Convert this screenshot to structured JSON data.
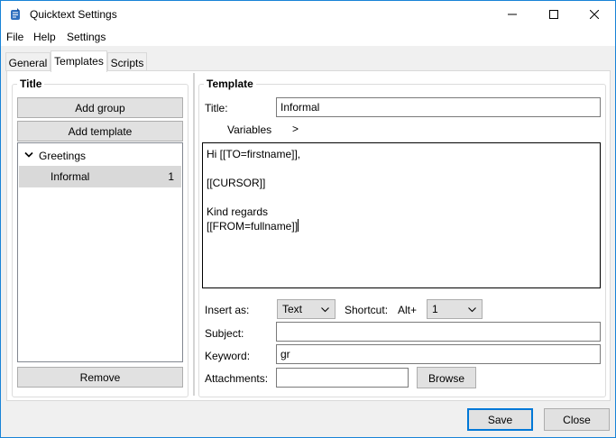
{
  "window": {
    "title": "Quicktext Settings"
  },
  "menu": [
    "File",
    "Help",
    "Settings"
  ],
  "tabs": [
    {
      "label": "General",
      "active": false
    },
    {
      "label": "Templates",
      "active": true
    },
    {
      "label": "Scripts",
      "active": false
    }
  ],
  "left_panel": {
    "title": "Title",
    "add_group_label": "Add group",
    "add_template_label": "Add template",
    "tree": {
      "group_label": "Greetings",
      "item_label": "Informal",
      "item_shortcut": "1"
    },
    "remove_label": "Remove"
  },
  "right_panel": {
    "title": "Template",
    "title_label": "Title:",
    "title_value": "Informal",
    "variables_label": "Variables",
    "variables_chevron": ">",
    "body_lines": [
      "Hi [[TO=firstname]],",
      "",
      "[[CURSOR]]",
      "",
      "Kind regards",
      "[[FROM=fullname]]"
    ],
    "insert_as_label": "Insert as:",
    "insert_as_value": "Text",
    "shortcut_label": "Shortcut:",
    "shortcut_modifier": "Alt+",
    "shortcut_value": "1",
    "subject_label": "Subject:",
    "subject_value": "",
    "keyword_label": "Keyword:",
    "keyword_value": "gr",
    "attachments_label": "Attachments:",
    "attachments_value": "",
    "browse_label": "Browse"
  },
  "footer": {
    "save_label": "Save",
    "close_label": "Close"
  },
  "colors": {
    "accent": "#0078d7",
    "selection": "#d9d9d9"
  }
}
